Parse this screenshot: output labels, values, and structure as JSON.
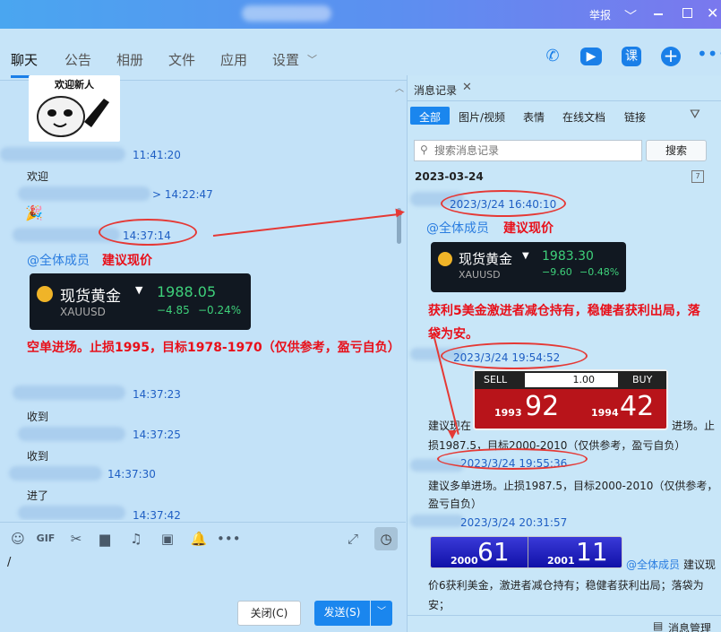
{
  "titlebar": {
    "report": "举报"
  },
  "nav": {
    "tabs": [
      "聊天",
      "公告",
      "相册",
      "文件",
      "应用",
      "设置"
    ]
  },
  "chat": {
    "sticker_caption": "欢迎新人",
    "m1_time": "11:41:20",
    "m1_text": "欢迎",
    "m2_time": "> 14:22:47",
    "m2_emoji": "🎉",
    "m3_time": "14:37:14",
    "mention": "@全体成员",
    "advice": "建议现价",
    "card1": {
      "name": "现货黄金",
      "code": "XAUUSD",
      "price": "1988.05",
      "change": "−4.85",
      "pct": "−0.24%"
    },
    "signal": "空单进场。止损1995，目标1978-1970（仅供参考，盈亏自负）",
    "m4_time": "14:37:23",
    "m4_text": "收到",
    "m5_time": "14:37:25",
    "m5_text": "收到",
    "m6_time": "14:37:30",
    "m6_text": "进了",
    "m7_time": "14:37:42"
  },
  "input": {
    "cursor": "/",
    "close_label": "关闭(C)",
    "send_label": "发送(S)"
  },
  "panel": {
    "title": "消息记录",
    "filters": [
      "全部",
      "图片/视频",
      "表情",
      "在线文档",
      "链接"
    ],
    "search_placeholder": "搜索消息记录",
    "search_button": "搜索",
    "date": "2023-03-24",
    "r1_time": "2023/3/24 16:40:10",
    "mention": "@全体成员",
    "advice": "建议现价",
    "card2": {
      "name": "现货黄金",
      "code": "XAUUSD",
      "price": "1983.30",
      "change": "−9.60",
      "pct": "−0.48%"
    },
    "profit_text": "获利5美金激进者减仓持有，稳健者获利出局，落袋为安。",
    "r2_time": "2023/3/24 19:54:52",
    "ticket": {
      "sell": "SELL",
      "buy": "BUY",
      "lot": "1.00",
      "sell_small": "1993",
      "sell_big": "92",
      "buy_small": "1994",
      "buy_big": "42"
    },
    "r2_text_a": "建议现在",
    "r2_text_b": "进场。止",
    "r2_text_c": "损1987.5，目标2000-2010（仅供参考，盈亏自负）",
    "r3_time": "2023/3/24 19:55:36",
    "r3_text": "建议多单进场。止损1987.5，目标2000-2010（仅供参考，盈亏自负）",
    "r4_time": "2023/3/24 20:31:57",
    "quote": {
      "a_small": "2000",
      "a_big": "61",
      "b_small": "2001",
      "b_big": "11"
    },
    "r4_mention": "@全体成员",
    "r4_text_a": "建议现",
    "r4_text_b": "价6获利美金，激进者减仓持有；稳健者获利出局；落袋为安；",
    "manage": "消息管理"
  }
}
